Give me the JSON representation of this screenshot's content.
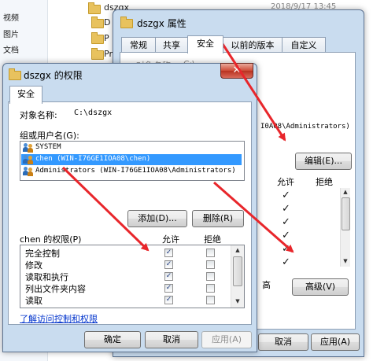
{
  "explorer": {
    "sidebar_items": [
      "视频",
      "图片",
      "文档"
    ],
    "files": [
      "dszgx",
      "D",
      "P",
      "Pr"
    ],
    "date": "2018/9/17 13:45"
  },
  "props": {
    "title": "dszgx 属性",
    "tabs": [
      "常规",
      "共享",
      "安全",
      "以前的版本",
      "自定义"
    ],
    "object_label_partial": "对象名称:",
    "object_value_partial": "C:\\",
    "admin_partial": "I0A08\\Administrators)",
    "edit_button": "编辑(E)...",
    "col_allow": "允许",
    "col_deny": "拒绝",
    "check_count": 6,
    "advanced_partial": "高",
    "advanced_button": "高级(V)",
    "cancel_button": "取消",
    "apply_button": "应用(A)"
  },
  "perm": {
    "title": "dszgx 的权限",
    "tab": "安全",
    "object_label": "对象名称:",
    "object_value": "C:\\dszgx",
    "group_label": "组或用户名(G):",
    "groups": [
      {
        "name": "SYSTEM",
        "selected": false
      },
      {
        "name": "chen (WIN-I76GE1IOA08\\chen)",
        "selected": true
      },
      {
        "name": "Administrators (WIN-I76GE1IOA08\\Administrators)",
        "selected": false
      }
    ],
    "add_button": "添加(D)...",
    "remove_button": "删除(R)",
    "perm_label": "chen 的权限(P)",
    "col_allow": "允许",
    "col_deny": "拒绝",
    "permissions": [
      {
        "name": "完全控制",
        "allow": true,
        "deny": false
      },
      {
        "name": "修改",
        "allow": true,
        "deny": false
      },
      {
        "name": "读取和执行",
        "allow": true,
        "deny": false
      },
      {
        "name": "列出文件夹内容",
        "allow": true,
        "deny": false
      },
      {
        "name": "读取",
        "allow": true,
        "deny": false
      }
    ],
    "help_link": "了解访问控制和权限",
    "ok_button": "确定",
    "cancel_button": "取消",
    "apply_button": "应用(A)"
  },
  "colors": {
    "selection": "#3399ff",
    "arrow": "#e8262b",
    "link": "#0033cc"
  }
}
